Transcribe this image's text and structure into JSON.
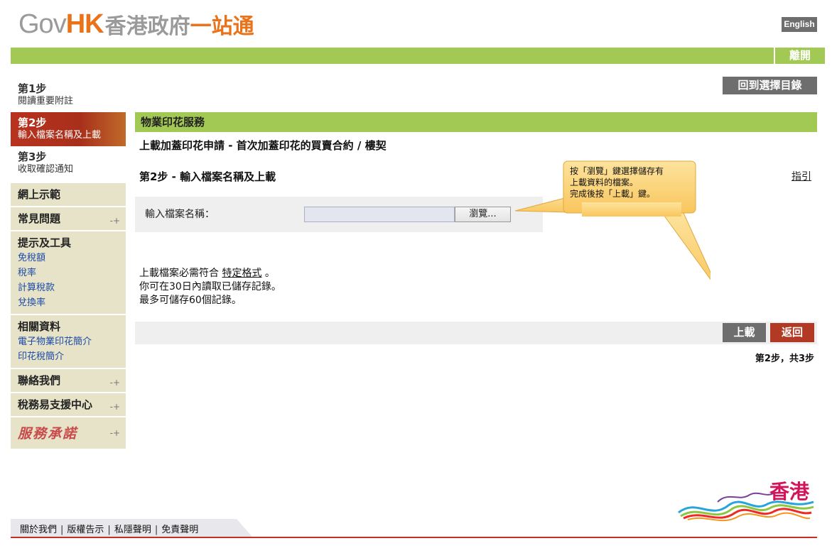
{
  "header": {
    "logo_gov": "Gov",
    "logo_hk": "HK",
    "logo_cn1": "香港政府",
    "logo_cn2": "一站通",
    "lang_button": "English",
    "leave_button": "離開"
  },
  "sidebar": {
    "steps": [
      {
        "num": "第1步",
        "desc": "閱讀重要附註"
      },
      {
        "num": "第2步",
        "desc": "輸入檔案名稱及上載"
      },
      {
        "num": "第3步",
        "desc": "收取確認通知"
      }
    ],
    "boxes": [
      {
        "title": "網上示範"
      },
      {
        "title": "常見問題"
      },
      {
        "title": "提示及工具",
        "links": [
          "免稅額",
          "稅率",
          "計算稅款",
          "兌換率"
        ]
      },
      {
        "title": "相關資料",
        "links": [
          "電子物業印花簡介",
          "印花稅簡介"
        ]
      },
      {
        "title": "聯絡我們"
      },
      {
        "title": "稅務易支援中心"
      },
      {
        "title": "服務承諾"
      }
    ]
  },
  "main": {
    "back_menu_button": "回到選擇目錄",
    "section_title": "物業印花服務",
    "subtitle": "上載加蓋印花申請 - 首次加蓋印花的買賣合約 / 樓契",
    "step_heading": "第2步 - 輸入檔案名稱及上載",
    "guide_link": "指引",
    "input_label": "輸入檔案名稱：",
    "file_value": "",
    "browse_button": "瀏覽...",
    "notes": {
      "line1_prefix": "上載檔案必需符合",
      "line1_link": "特定格式",
      "line1_suffix": "。",
      "line2": "你可在30日內讀取已儲存記錄。",
      "line3": "最多可儲存60個記錄。"
    },
    "upload_button": "上載",
    "return_button": "返回",
    "step_count": "第2步，共3步"
  },
  "tooltip": {
    "line1": "按「瀏覽」鍵選擇儲存有",
    "line2": "上載資料的檔案。",
    "line3": "完成後按「上載」鍵。"
  },
  "footer": {
    "links": [
      "關於我們",
      "版權告示",
      "私隱聲明",
      "免責聲明"
    ],
    "brand": "香港"
  },
  "colors": {
    "green": "#a3c955",
    "red": "#b23a24",
    "grey_button": "#6e6e6e",
    "sidebar_bg": "#e6e3c8",
    "tooltip_bg": "#fbd37a"
  }
}
